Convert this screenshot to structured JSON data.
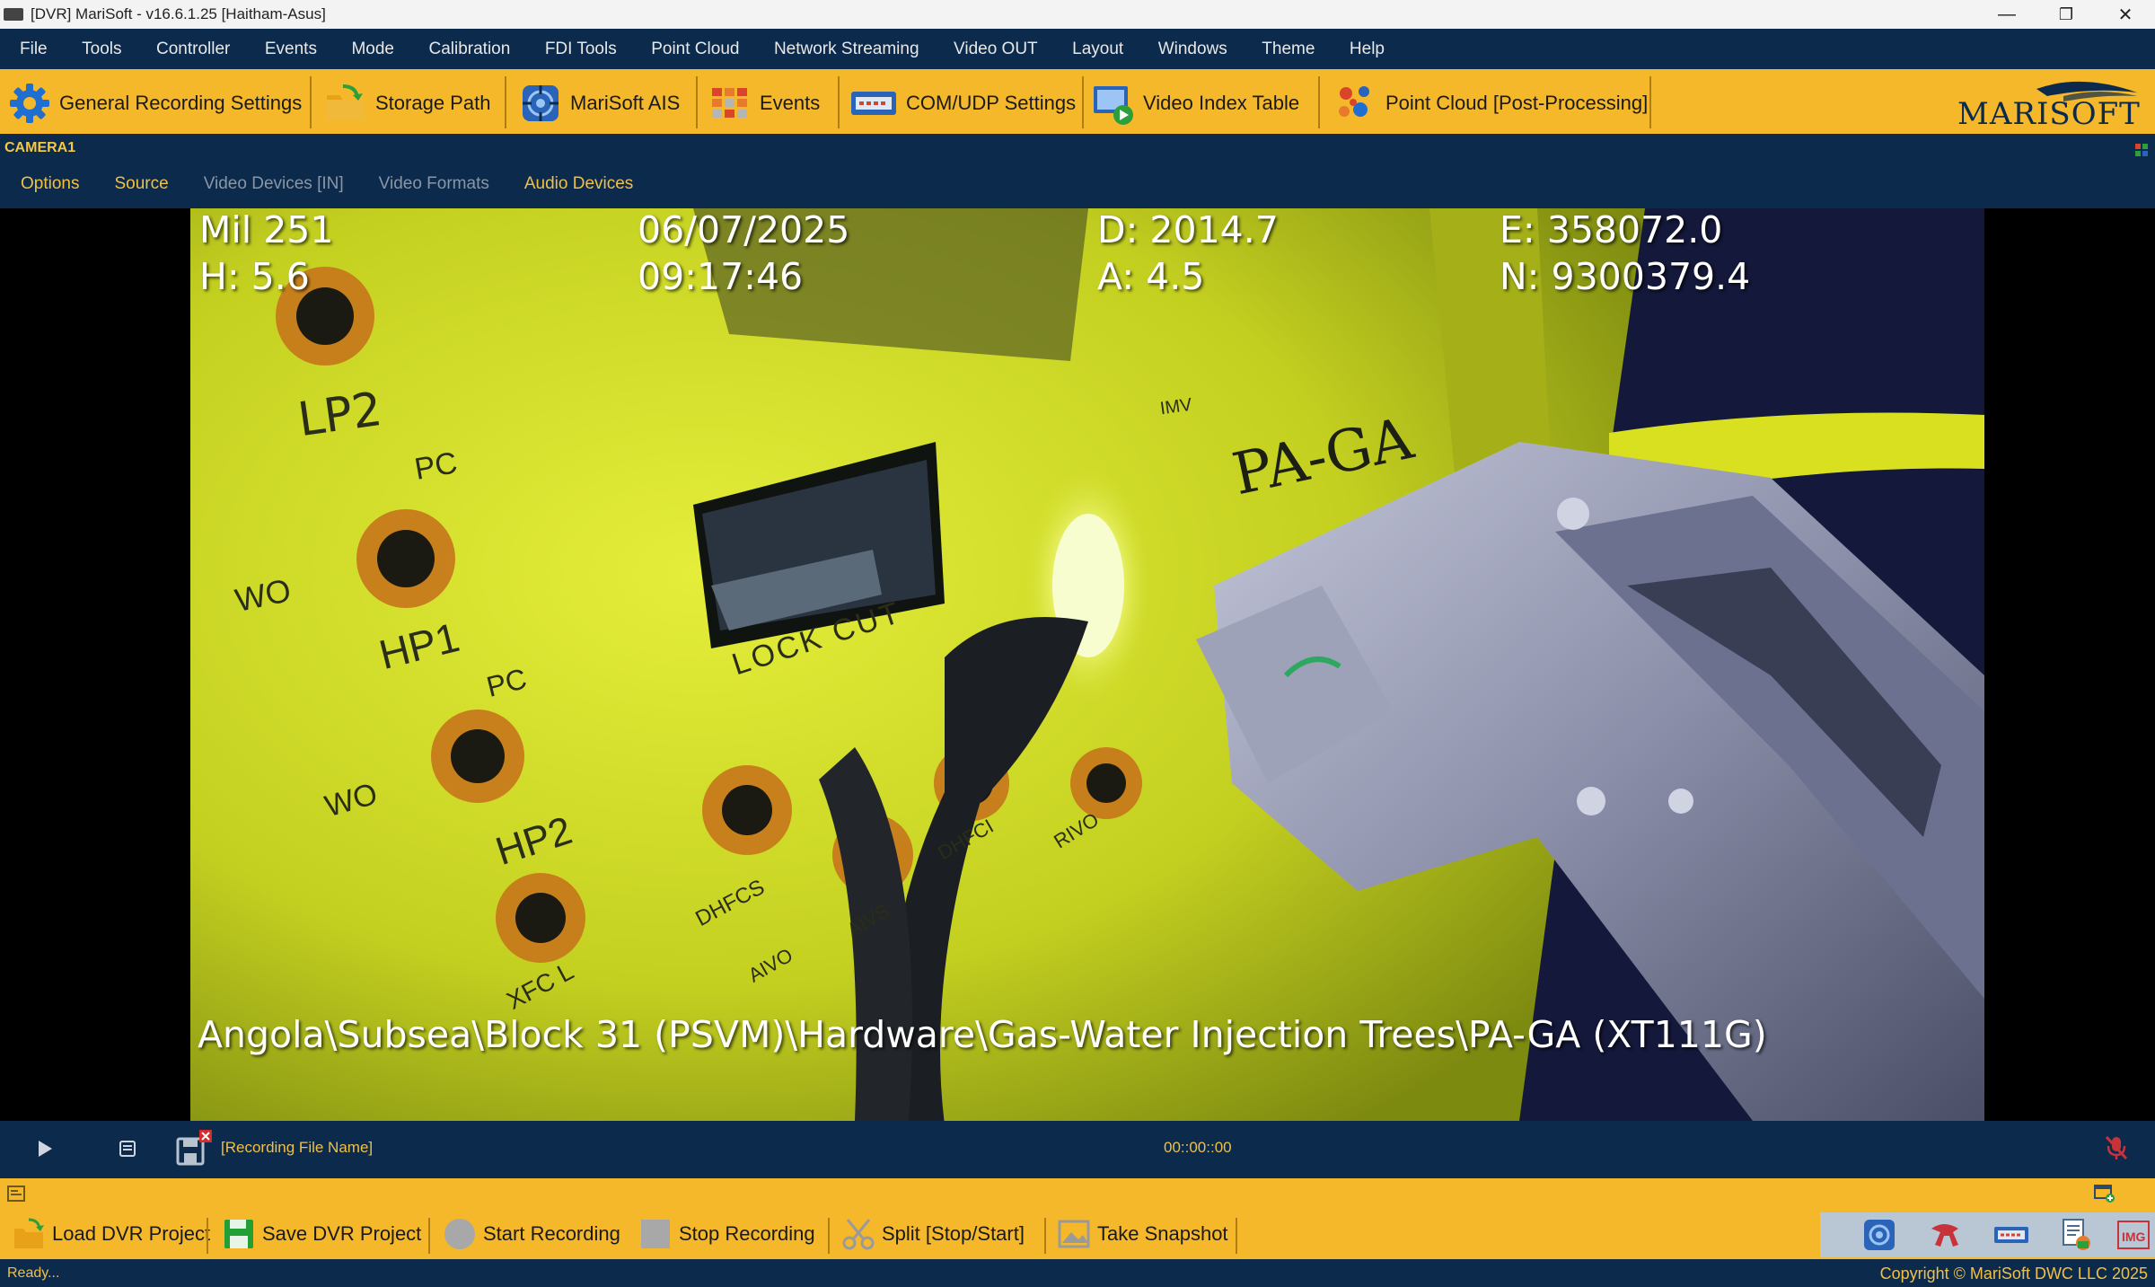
{
  "window": {
    "title": "[DVR] MariSoft - v16.6.1.25 [Haitham-Asus]",
    "minimize_glyph": "—",
    "restore_glyph": "❐",
    "close_glyph": "✕"
  },
  "menu": [
    "File",
    "Tools",
    "Controller",
    "Events",
    "Mode",
    "Calibration",
    "FDI Tools",
    "Point Cloud",
    "Network Streaming",
    "Video OUT",
    "Layout",
    "Windows",
    "Theme",
    "Help"
  ],
  "toolbar": {
    "general_recording": "General Recording Settings",
    "storage_path": "Storage Path",
    "marisoft_ais": "MariSoft AIS",
    "events": "Events",
    "com_udp": "COM/UDP Settings",
    "video_index": "Video Index Table",
    "point_cloud": "Point Cloud [Post-Processing]",
    "logo_text": "MARISOFT"
  },
  "camera": {
    "name": "CAMERA1",
    "tabs": [
      "Options",
      "Source",
      "Video Devices [IN]",
      "Video Formats",
      "Audio Devices"
    ],
    "tab_enabled": [
      true,
      true,
      false,
      false,
      true
    ]
  },
  "overlay": {
    "mil": "Mil 251",
    "heading": "H: 5.6",
    "date": "06/07/2025",
    "time": "09:17:46",
    "depth": "D: 2014.7",
    "altitude": "A: 4.5",
    "easting": "E: 358072.0",
    "northing": "N: 9300379.4",
    "path": "Angola\\Subsea\\Block 31 (PSVM)\\Hardware\\Gas-Water Injection Trees\\PA-GA (XT111G)"
  },
  "panel_markings": {
    "lp2": "LP2",
    "pc1": "PC",
    "pc2": "PC",
    "pc3": "PC",
    "hp1": "HP1",
    "hp2": "HP2",
    "wo1": "WO",
    "wo2": "WO",
    "lock_cut": "LOCK CUT",
    "pa_ga": "PA-GA",
    "dhfcs": "DHFCS",
    "dhfci": "DHFCI",
    "aivs": "AIVS",
    "aivo": "AIVO",
    "rivo": "RIVO",
    "xfcl": "XFC L",
    "imv": "IMV"
  },
  "playback": {
    "recording_file": "[Recording File Name]",
    "timecode": "00::00::00"
  },
  "bottom": {
    "load": "Load DVR Project",
    "save": "Save DVR Project",
    "start": "Start Recording",
    "stop": "Stop Recording",
    "split": "Split [Stop/Start]",
    "snapshot": "Take Snapshot"
  },
  "status": {
    "left": "Ready...",
    "right": "Copyright © MariSoft DWC LLC 2025"
  },
  "colors": {
    "accent_yellow": "#f5b82a",
    "navy": "#0b2a4c",
    "disabled_text": "#8a96a6"
  },
  "icons": {
    "general_recording": "gear-icon",
    "storage_path": "folder-arrow-icon",
    "marisoft_ais": "target-icon",
    "events": "grid-icon",
    "com_udp": "port-icon",
    "video_index": "video-play-icon",
    "point_cloud": "dots-icon"
  }
}
